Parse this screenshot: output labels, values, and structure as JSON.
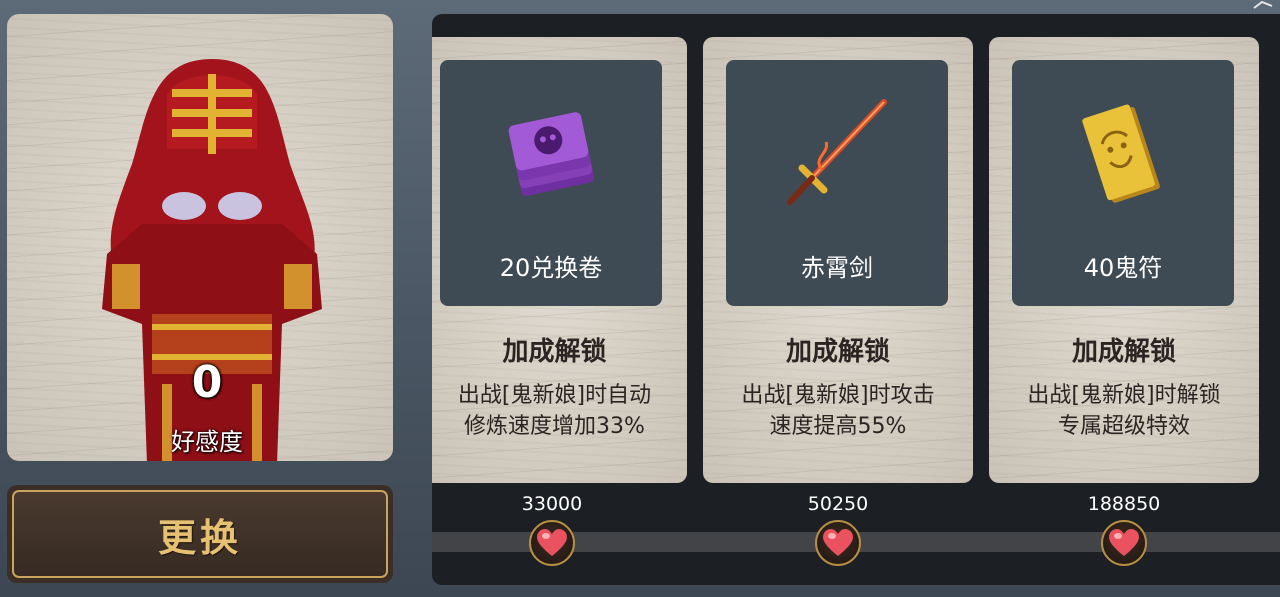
{
  "portrait": {
    "character_icon": "ghost-bride-figure",
    "affinity_value": "0",
    "affinity_label": "好感度"
  },
  "change_button": {
    "label": "更换"
  },
  "rewards": [
    {
      "item_name": "20兑换卷",
      "item_icon": "purple-ticket-stack-icon",
      "title": "加成解锁",
      "desc_line1": "出战[鬼新娘]时自动",
      "desc_line2": "修炼速度增加33%",
      "threshold": "33000"
    },
    {
      "item_name": "赤霄剑",
      "item_icon": "red-sword-icon",
      "title": "加成解锁",
      "desc_line1": "出战[鬼新娘]时攻击",
      "desc_line2": "速度提高55%",
      "threshold": "50250"
    },
    {
      "item_name": "40鬼符",
      "item_icon": "gold-talisman-stack-icon",
      "title": "加成解锁",
      "desc_line1": "出战[鬼新娘]时解锁",
      "desc_line2": "专属超级特效",
      "threshold": "188850"
    }
  ],
  "colors": {
    "button_text": "#e6c171",
    "button_border": "#c9a45e",
    "slot_bg": "#3e4a54",
    "panel_bg": "#1c1f23",
    "heart": "#e9525e"
  }
}
